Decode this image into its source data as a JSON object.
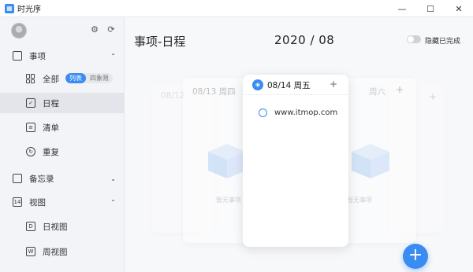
{
  "window": {
    "title": "时光序",
    "app_icon": "calendar-app-icon",
    "controls": {
      "minimize": "—",
      "maximize": "☐",
      "close": "✕"
    }
  },
  "sidebar": {
    "items": [
      {
        "label": "事项",
        "icon": "inbox-icon",
        "expanded": true
      },
      {
        "label": "全部",
        "icon": "grid-icon"
      },
      {
        "label": "日程",
        "icon": "checkbox-icon",
        "active": true
      },
      {
        "label": "清单",
        "icon": "list-icon"
      },
      {
        "label": "重复",
        "icon": "repeat-icon"
      },
      {
        "label": "备忘录",
        "icon": "memo-icon",
        "expanded": false
      },
      {
        "label": "视图",
        "icon": "calendar-14-icon",
        "badge": "14",
        "expanded": true
      },
      {
        "label": "日视图",
        "icon": "day-view-icon",
        "badge": "D"
      },
      {
        "label": "周视图",
        "icon": "week-view-icon",
        "badge": "W"
      }
    ],
    "view_toggle": {
      "list": "列表",
      "quadrant": "四象限"
    }
  },
  "main": {
    "title": "事项-日程",
    "month": "2020 / 08",
    "hide_completed": "隐藏已完成",
    "cards": {
      "far_left": "08/12",
      "left": "08/13 周四",
      "center": "08/14 周五",
      "right": "周六",
      "empty_text": "暂无事项"
    },
    "task": "www.itmop.com",
    "add": "+"
  },
  "colors": {
    "accent": "#3b8cf0"
  }
}
